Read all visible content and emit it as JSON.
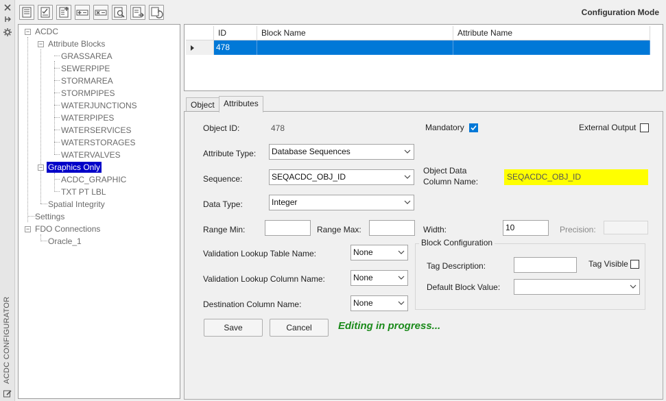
{
  "side_strip": {
    "title": "ACDC CONFIGURATOR",
    "icons": [
      "close-icon",
      "pin-icon",
      "settings-icon",
      "edit-icon"
    ]
  },
  "toolbar": {
    "mode_title": "Configuration Mode",
    "buttons": [
      "new-config-icon",
      "checklist-icon",
      "add-list-icon",
      "add-row-icon",
      "remove-row-icon",
      "preview-icon",
      "export-icon",
      "refresh-icon"
    ]
  },
  "tree": {
    "root": "ACDC",
    "attribute_blocks": "Attribute Blocks",
    "blocks": [
      "GRASSAREA",
      "SEWERPIPE",
      "STORMAREA",
      "STORMPIPES",
      "WATERJUNCTIONS",
      "WATERPIPES",
      "WATERSERVICES",
      "WATERSTORAGES",
      "WATERVALVES"
    ],
    "graphics_only": "Graphics Only",
    "graphics": [
      "ACDC_GRAPHIC",
      "TXT PT LBL"
    ],
    "spatial_integrity": "Spatial Integrity",
    "settings": "Settings",
    "fdo_connections": "FDO Connections",
    "connections": [
      "Oracle_1"
    ],
    "expanders": [
      "−",
      "−",
      "−",
      "−"
    ]
  },
  "grid": {
    "columns": [
      "ID",
      "Block Name",
      "Attribute Name"
    ],
    "rows": [
      {
        "id": "478",
        "block_name": "",
        "attribute_name": ""
      }
    ]
  },
  "tabs": [
    "Object",
    "Attributes"
  ],
  "form": {
    "object_id_label": "Object ID:",
    "object_id_value": "478",
    "mandatory_label": "Mandatory",
    "mandatory_checked": true,
    "external_output_label": "External Output",
    "external_output_checked": false,
    "attribute_type_label": "Attribute Type:",
    "attribute_type_value": "Database Sequences",
    "sequence_label": "Sequence:",
    "sequence_value": "SEQACDC_OBJ_ID",
    "object_data_column_label_1": "Object Data",
    "object_data_column_label_2": "Column Name:",
    "object_data_column_value": "SEQACDC_OBJ_ID",
    "data_type_label": "Data Type:",
    "data_type_value": "Integer",
    "range_min_label": "Range Min:",
    "range_min_value": "",
    "range_max_label": "Range Max:",
    "range_max_value": "",
    "width_label": "Width:",
    "width_value": "10",
    "precision_label": "Precision:",
    "precision_value": "",
    "validation_table_label": "Validation Lookup Table Name:",
    "validation_table_value": "None",
    "validation_column_label": "Validation Lookup Column Name:",
    "validation_column_value": "None",
    "destination_column_label": "Destination Column Name:",
    "destination_column_value": "None",
    "block_config_title": "Block Configuration",
    "tag_description_label": "Tag Description:",
    "tag_description_value": "",
    "tag_visible_label": "Tag Visible",
    "tag_visible_checked": false,
    "default_block_value_label": "Default Block Value:",
    "default_block_value": "",
    "save_label": "Save",
    "cancel_label": "Cancel",
    "status_text": "Editing in progress...",
    "colors": {
      "accent": "#0078d7",
      "highlight": "#ffff00",
      "status": "#1a8a1a",
      "tree_selection": "#0000c8"
    }
  }
}
